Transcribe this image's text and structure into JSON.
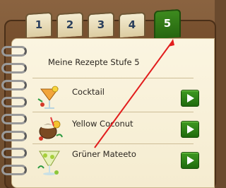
{
  "tabs": [
    {
      "label": "1",
      "active": false
    },
    {
      "label": "2",
      "active": false
    },
    {
      "label": "3",
      "active": false
    },
    {
      "label": "4",
      "active": false
    },
    {
      "label": "5",
      "active": true
    }
  ],
  "page_title": "Meine Rezepte Stufe 5",
  "recipes": [
    {
      "name": "Cocktail",
      "icon": "cocktail-glass-icon"
    },
    {
      "name": "Yellow Coconut",
      "icon": "coconut-drink-icon"
    },
    {
      "name": "Grüner Mateeto",
      "icon": "mojito-glass-icon"
    }
  ],
  "colors": {
    "active_tab": "#2e7a16",
    "tab_text": "#2a3f5c",
    "paper": "#f8f0d8",
    "annotation_arrow": "#e21d1d"
  }
}
